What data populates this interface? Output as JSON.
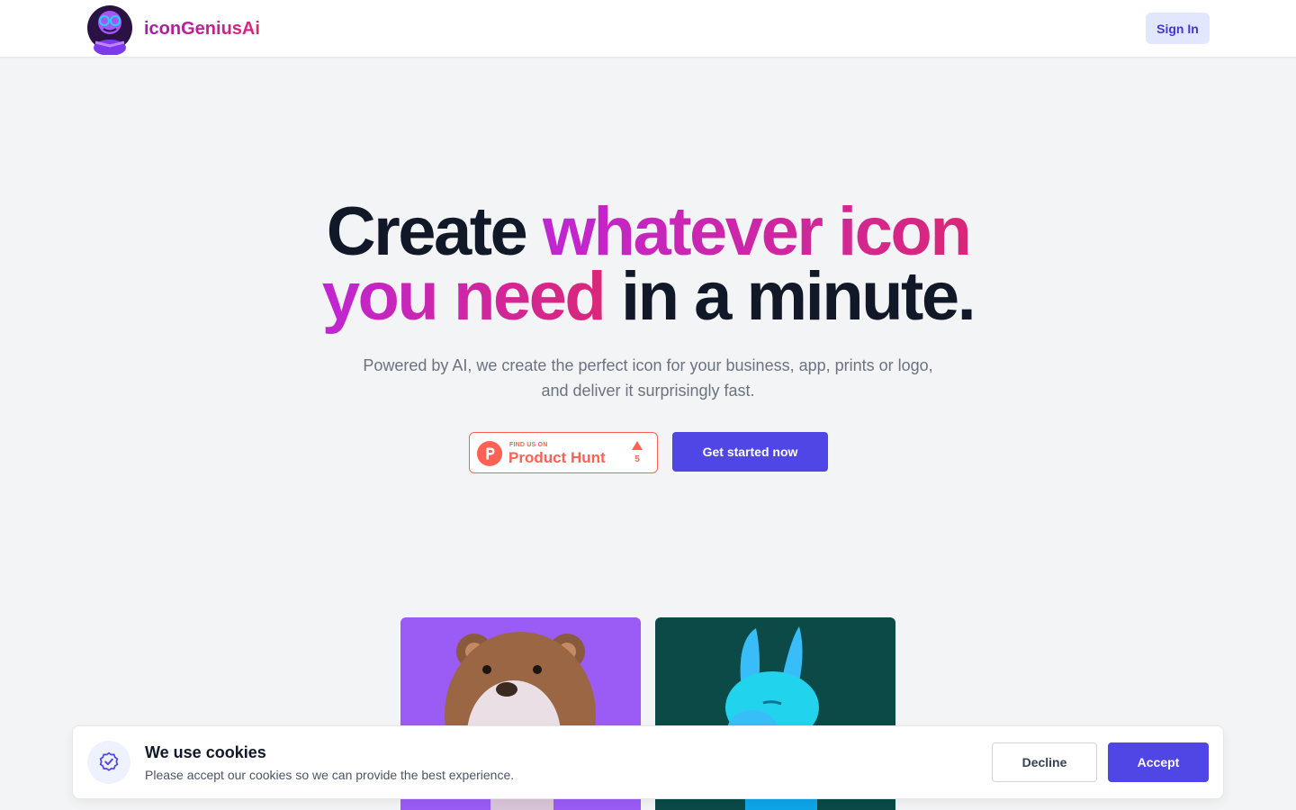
{
  "header": {
    "brand_name": "iconGeniusAi",
    "signin_label": "Sign In"
  },
  "hero": {
    "title_part1": "Create ",
    "title_highlight1": "whatever icon",
    "title_highlight2": "you need",
    "title_part2": " in a minute.",
    "subtitle": "Powered by AI, we create the perfect icon for your business, app, prints or logo, and deliver it surprisingly fast.",
    "producthunt": {
      "small_text": "FIND US ON",
      "big_text": "Product Hunt",
      "upvotes": "5"
    },
    "cta_label": "Get started now"
  },
  "gallery": [
    {
      "icon": "bear-3d-icon",
      "bg": "#9b5cf6"
    },
    {
      "icon": "llama-3d-icon",
      "bg": "#0b4a47"
    }
  ],
  "cookie_banner": {
    "title": "We use cookies",
    "text": "Please accept our cookies so we can provide the best experience.",
    "decline_label": "Decline",
    "accept_label": "Accept",
    "icon": "check-badge-icon"
  },
  "colors": {
    "accent": "#4f46e5",
    "brand_gradient_start": "#c026d3",
    "brand_gradient_end": "#db2777",
    "producthunt": "#ff6154"
  }
}
